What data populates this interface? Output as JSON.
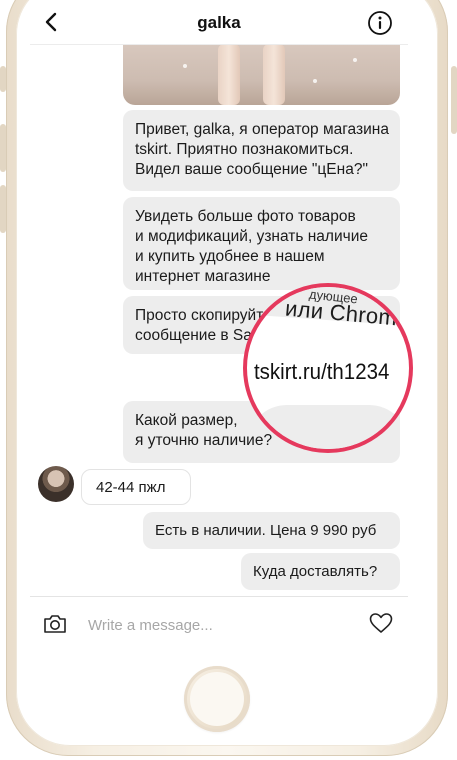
{
  "header": {
    "title": "galka"
  },
  "messages": {
    "m1": [
      "Привет, galka, я оператор магазина",
      "tskirt. Приятно познакомиться.",
      "Видел ваше сообщение \"цЕна?\""
    ],
    "m2": [
      "Увидеть больше фото товаров",
      "и модификаций, узнать наличие",
      "и купить удобнее в нашем",
      "интернет магазине"
    ],
    "m3": [
      "Просто скопируйте",
      "сообщение в Sa"
    ],
    "m4": [
      "Какой размер,",
      "я уточню наличие?"
    ],
    "reply": "42-44 пжл",
    "m6": "Есть в наличии. Цена 9 990 руб",
    "m7": "Куда доставлять?"
  },
  "magnifier": {
    "partial_text": "дующее",
    "chrome_text": "или Chrome",
    "url_text": "tskirt.ru/th1234",
    "ring_color": "#e5395d"
  },
  "composer": {
    "placeholder": "Write a message..."
  },
  "icons": {
    "back": "chevron-left-icon",
    "info": "info-icon",
    "camera": "camera-icon",
    "heart": "heart-icon"
  }
}
